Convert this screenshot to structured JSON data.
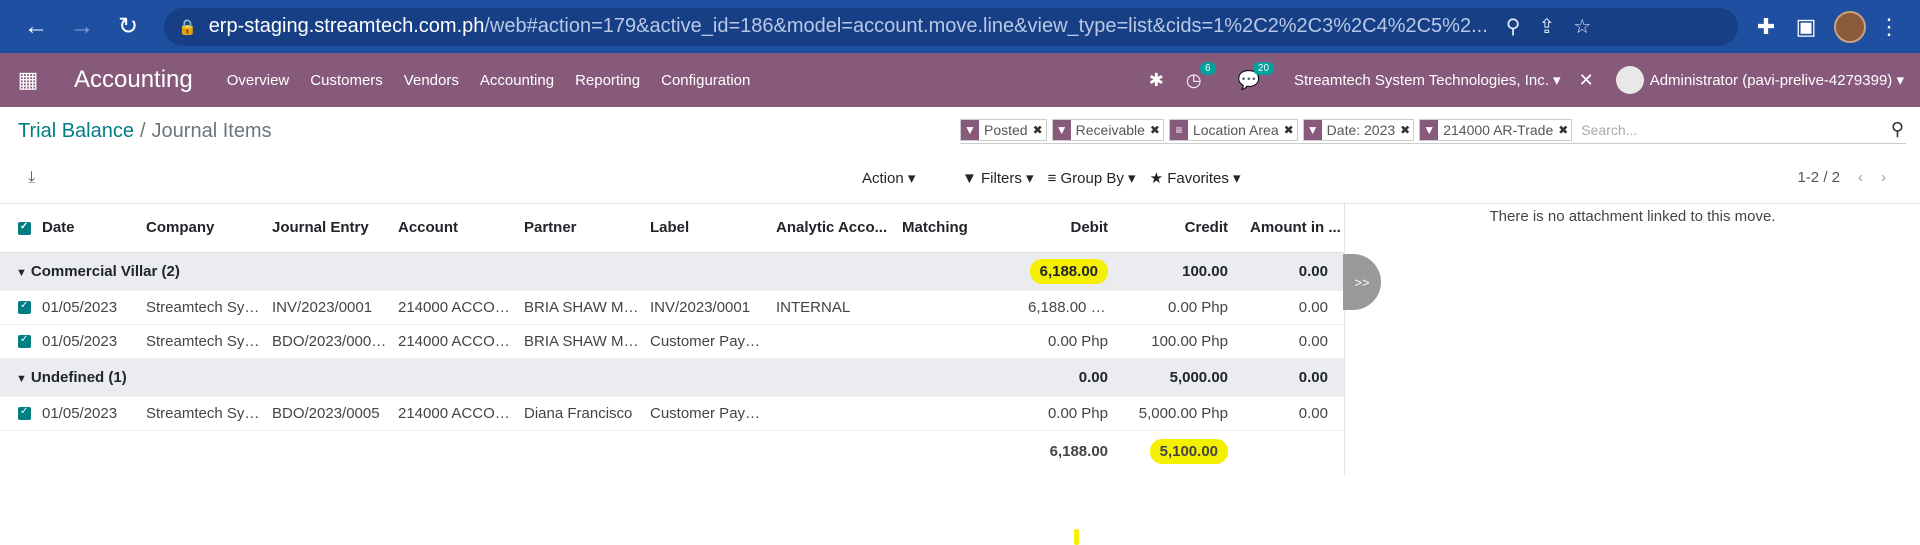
{
  "browser": {
    "url_host": "erp-staging.streamtech.com.ph",
    "url_path": "/web#action=179&active_id=186&model=account.move.line&view_type=list&cids=1%2C2%2C3%2C4%2C5%2..."
  },
  "nav": {
    "app_name": "Accounting",
    "menu": [
      "Overview",
      "Customers",
      "Vendors",
      "Accounting",
      "Reporting",
      "Configuration"
    ],
    "activity_count": "6",
    "message_count": "20",
    "company": "Streamtech System Technologies, Inc.",
    "user": "Administrator (pavi-prelive-4279399)"
  },
  "control_panel": {
    "breadcrumb_parent": "Trial Balance",
    "breadcrumb_current": "Journal Items",
    "facets": [
      "Posted",
      "Receivable",
      "Location Area",
      "Date: 2023",
      "214000 AR-Trade"
    ],
    "search_placeholder": "Search...",
    "action_label": "Action",
    "filters_label": "Filters",
    "groupby_label": "Group By",
    "favorites_label": "Favorites",
    "pager": "1-2 / 2"
  },
  "table": {
    "columns": [
      "Date",
      "Company",
      "Journal Entry",
      "Account",
      "Partner",
      "Label",
      "Analytic Acco...",
      "Matching",
      "Debit",
      "Credit",
      "Amount in ..."
    ],
    "groups": [
      {
        "name": "Commercial Villar (2)",
        "debit": "6,188.00",
        "credit": "100.00",
        "amount": "0.00",
        "rows": [
          {
            "date": "01/05/2023",
            "company": "Streamtech Syst...",
            "entry": "INV/2023/0001",
            "account": "214000 ACCOU...",
            "partner": "BRIA SHAW MA...",
            "label": "INV/2023/0001",
            "analytic": "INTERNAL",
            "matching": "",
            "debit": "6,188.00 Php",
            "credit": "0.00 Php",
            "amount": "0.00"
          },
          {
            "date": "01/05/2023",
            "company": "Streamtech Syst...",
            "entry": "BDO/2023/0006...",
            "account": "214000 ACCOU...",
            "partner": "BRIA SHAW MA...",
            "label": "Customer Paym...",
            "analytic": "",
            "matching": "",
            "debit": "0.00 Php",
            "credit": "100.00 Php",
            "amount": "0.00"
          }
        ]
      },
      {
        "name": "Undefined (1)",
        "debit": "0.00",
        "credit": "5,000.00",
        "amount": "0.00",
        "rows": [
          {
            "date": "01/05/2023",
            "company": "Streamtech Syst...",
            "entry": "BDO/2023/0005",
            "account": "214000 ACCOU...",
            "partner": "Diana Francisco",
            "label": "Customer Paym...",
            "analytic": "",
            "matching": "",
            "debit": "0.00 Php",
            "credit": "5,000.00 Php",
            "amount": "0.00"
          }
        ]
      }
    ],
    "footer": {
      "debit": "6,188.00",
      "credit": "5,100.00"
    }
  },
  "chatter": {
    "message": "There is no attachment linked to this move.",
    "toggle": ">>"
  }
}
